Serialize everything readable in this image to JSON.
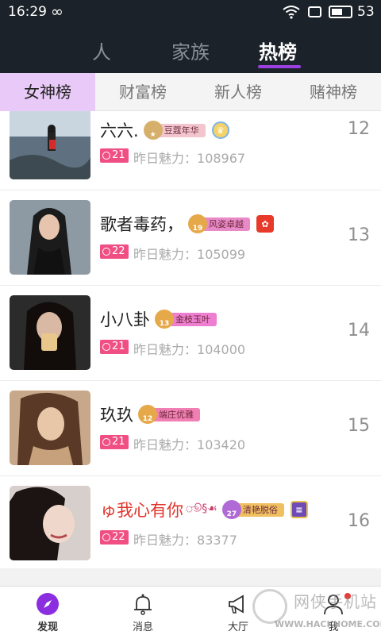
{
  "status_bar": {
    "time": "16:29",
    "battery": "53"
  },
  "top_tabs": [
    {
      "label": "人",
      "active": false
    },
    {
      "label": "家族",
      "active": false
    },
    {
      "label": "热榜",
      "active": true
    }
  ],
  "sub_tabs": [
    {
      "label": "女神榜",
      "active": true
    },
    {
      "label": "财富榜",
      "active": false
    },
    {
      "label": "新人榜",
      "active": false
    },
    {
      "label": "赌神榜",
      "active": false
    }
  ],
  "charm_label": "昨日魅力：",
  "rows": [
    {
      "name": "六六.",
      "badge_num": "",
      "badge_title": "豆蔻年华",
      "level": "21",
      "charm": "108967",
      "rank": "12"
    },
    {
      "name": "歌者毒药，",
      "badge_num": "19",
      "badge_title": "风姿卓越",
      "level": "22",
      "charm": "105099",
      "rank": "13"
    },
    {
      "name": "小八卦",
      "badge_num": "13",
      "badge_title": "金枝玉叶",
      "level": "21",
      "charm": "104000",
      "rank": "14"
    },
    {
      "name": "玖玖",
      "badge_num": "12",
      "badge_title": "端庄优雅",
      "level": "21",
      "charm": "103420",
      "rank": "15"
    },
    {
      "name": "ゅ我心有你",
      "flourish": "ூ§☙",
      "badge_num": "27",
      "badge_title": "清艳脱俗",
      "level": "22",
      "charm": "83377",
      "rank": "16"
    }
  ],
  "bottom_nav": [
    {
      "label": "发现",
      "icon": "compass-icon",
      "active": true
    },
    {
      "label": "消息",
      "icon": "bell-icon",
      "active": false
    },
    {
      "label": "大厅",
      "icon": "megaphone-icon",
      "active": false
    },
    {
      "label": "我",
      "icon": "person-icon",
      "active": false
    }
  ],
  "watermark": {
    "title": "网侠手机站",
    "url": "WWW.HACKHOME.COM"
  },
  "colors": {
    "dark_header": "#1c2229",
    "accent_purple": "#9b3fe0",
    "active_subtab_bg": "#e8c9f7",
    "level_pink": "#f04f84"
  }
}
